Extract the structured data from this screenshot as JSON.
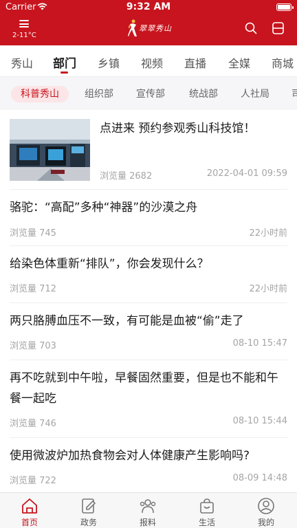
{
  "status_bar": {
    "carrier": "Carrier",
    "time": "9:32 AM"
  },
  "header": {
    "weather": "2-11°C",
    "logo_text": "翠翠秀山"
  },
  "channels": [
    "秀山",
    "部门",
    "乡镇",
    "视频",
    "直播",
    "全媒",
    "商城"
  ],
  "active_channel_index": 1,
  "subtabs": [
    "科普秀山",
    "组织部",
    "宣传部",
    "统战部",
    "人社局",
    "司"
  ],
  "active_subtab_index": 0,
  "articles": [
    {
      "title": "点进来 预约参观秀山科技馆！",
      "views": "浏览量 2682",
      "date": "2022-04-01 09:59",
      "has_image": true
    },
    {
      "title": "骆驼：“高配”多种“神器”的沙漠之舟",
      "views": "浏览量 745",
      "date": "22小时前"
    },
    {
      "title": "给染色体重新“排队”，你会发现什么？",
      "views": "浏览量 712",
      "date": "22小时前"
    },
    {
      "title": "两只胳膊血压不一致，有可能是血被“偷”走了",
      "views": "浏览量 703",
      "date": "08-10 15:47"
    },
    {
      "title": "再不吃就到中午啦，早餐固然重要，但是也不能和午餐一起吃",
      "views": "浏览量 746",
      "date": "08-10 15:44"
    },
    {
      "title": "使用微波炉加热食物会对人体健康产生影响吗?",
      "views": "浏览量 722",
      "date": "08-09 14:48"
    }
  ],
  "bottom_nav": [
    {
      "label": "首页",
      "icon": "home-icon"
    },
    {
      "label": "政务",
      "icon": "edit-document-icon"
    },
    {
      "label": "报料",
      "icon": "people-icon"
    },
    {
      "label": "生活",
      "icon": "shopping-bag-icon"
    },
    {
      "label": "我的",
      "icon": "user-icon"
    }
  ],
  "active_nav_index": 0,
  "colors": {
    "brand": "#c8141e",
    "text": "#1c1c1c",
    "meta": "#a5a5a5",
    "subtab_bg": "#f6f5f8",
    "subtab_active_bg": "#fbe5e6"
  }
}
